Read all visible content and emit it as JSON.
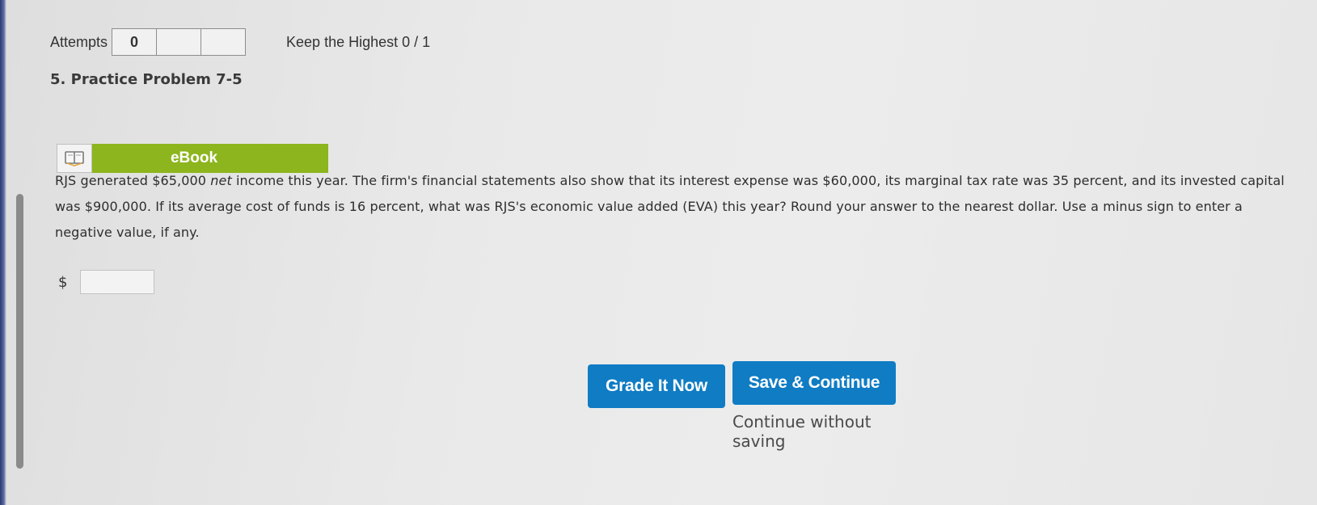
{
  "attempts": {
    "label": "Attempts",
    "boxes": [
      "0",
      "",
      ""
    ],
    "keep_highest": "Keep the Highest 0 / 1"
  },
  "problem": {
    "title": "5.  Practice Problem 7-5",
    "ebook_label": "eBook",
    "text_part1": "RJS generated $65,000 ",
    "text_italic": "net",
    "text_part2": " income this year. The firm's financial statements also show that its interest expense was $60,000, its marginal tax rate was 35 percent, and its invested capital was $900,000. If its average cost of funds is 16 percent, what was RJS's economic value added (EVA) this year? Round your answer to the nearest dollar. Use a minus sign to enter a negative value, if any.",
    "currency_symbol": "$",
    "answer_value": ""
  },
  "actions": {
    "grade_label": "Grade It Now",
    "save_label": "Save & Continue",
    "continue_label": "Continue without saving"
  },
  "colors": {
    "primary_button": "#0f7cc4",
    "ebook_green": "#8db51d"
  },
  "icons": {
    "ebook": "book-icon"
  }
}
